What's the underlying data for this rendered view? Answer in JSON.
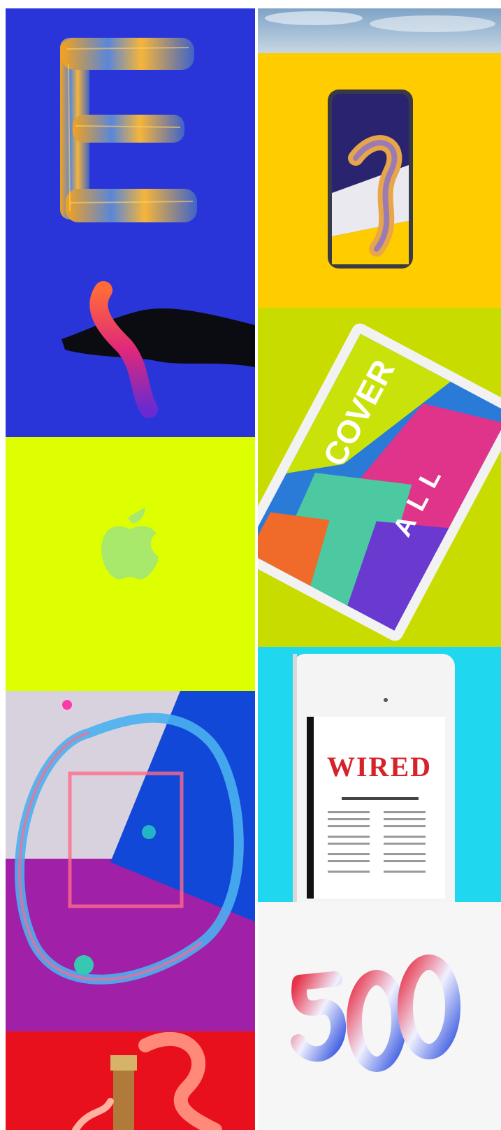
{
  "gallery": {
    "tiles": [
      {
        "name": "brush-letter-e",
        "background": "#2a35d9"
      },
      {
        "name": "sky-strip",
        "background": "#a9c2d8"
      },
      {
        "name": "phone-mockup",
        "background": "#ffcc00"
      },
      {
        "name": "hand-silhouette",
        "background": "#2a35d9"
      },
      {
        "name": "tablet-cover-all",
        "background": "#c9dc00"
      },
      {
        "name": "apple-logo",
        "background": "#ddff00"
      },
      {
        "name": "ipad-wired",
        "background": "#1fd8f0"
      },
      {
        "name": "paint-ring",
        "background": "#d8d2de"
      },
      {
        "name": "number-500",
        "background": "#f6f6f6"
      },
      {
        "name": "bottle-paint",
        "background": "#e8101c"
      }
    ],
    "cover_tablet": {
      "word_cover": "COVER",
      "word_all": "ALL"
    },
    "ipad": {
      "masthead": "WIRED"
    }
  }
}
